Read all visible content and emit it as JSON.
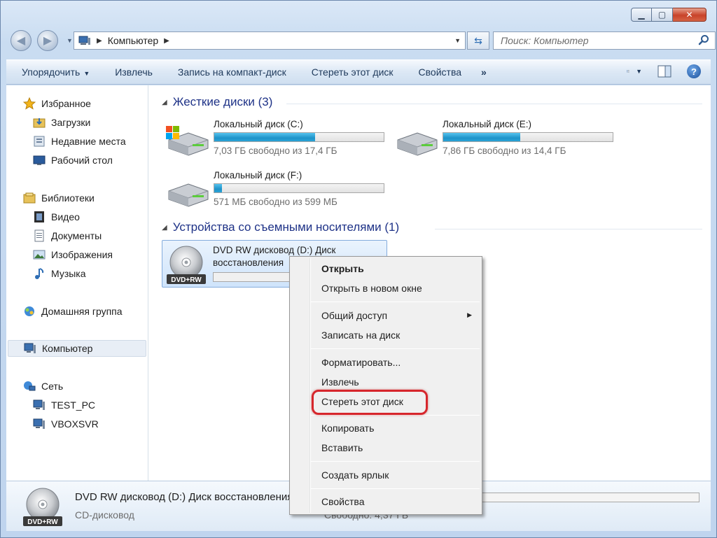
{
  "window": {
    "minimize_symbol": "▁",
    "maximize_symbol": "▢",
    "close_symbol": "✕"
  },
  "address_bar": {
    "crumb": "Компьютер",
    "search_placeholder": "Поиск: Компьютер"
  },
  "toolbar": {
    "organize": "Упорядочить",
    "eject": "Извлечь",
    "burn": "Запись на компакт-диск",
    "erase": "Стереть этот диск",
    "properties": "Свойства",
    "more": "»"
  },
  "sidebar": {
    "favorites": "Избранное",
    "downloads": "Загрузки",
    "recent": "Недавние места",
    "desktop": "Рабочий стол",
    "libraries": "Библиотеки",
    "video": "Видео",
    "documents": "Документы",
    "images": "Изображения",
    "music": "Музыка",
    "homegroup": "Домашняя группа",
    "computer": "Компьютер",
    "network": "Сеть",
    "net_pc1": "TEST_PC",
    "net_pc2": "VBOXSVR"
  },
  "main": {
    "hard_disks_header": "Жесткие диски (3)",
    "removable_header": "Устройства со съемными носителями (1)",
    "drives": [
      {
        "name": "Локальный диск (C:)",
        "free_text": "7,03 ГБ свободно из 17,4 ГБ",
        "used_fraction": 0.596
      },
      {
        "name": "Локальный диск (E:)",
        "free_text": "7,86 ГБ свободно из 14,4 ГБ",
        "used_fraction": 0.454
      },
      {
        "name": "Локальный диск (F:)",
        "free_text": "571 МБ свободно из 599 МБ",
        "used_fraction": 0.047
      }
    ],
    "dvd": {
      "line1": "DVD RW дисковод (D:) Диск",
      "line2": "восстановления",
      "label": "DVD+RW"
    }
  },
  "details": {
    "title": "DVD RW дисковод (D:) Диск восстановления",
    "subtitle": "CD-дисковод",
    "free": "Свободно: 4,37 ГБ",
    "label": "DVD+RW"
  },
  "context_menu": {
    "open": "Открыть",
    "open_new_window": "Открыть в новом окне",
    "share": "Общий доступ",
    "burn": "Записать на диск",
    "format": "Форматировать...",
    "eject": "Извлечь",
    "erase": "Стереть этот диск",
    "copy": "Копировать",
    "paste": "Вставить",
    "shortcut": "Создать ярлык",
    "properties": "Свойства"
  },
  "colors": {
    "accent_highlight": "#d6262c",
    "drive_fill": "#1e93c9",
    "group_header": "#1e3287"
  }
}
